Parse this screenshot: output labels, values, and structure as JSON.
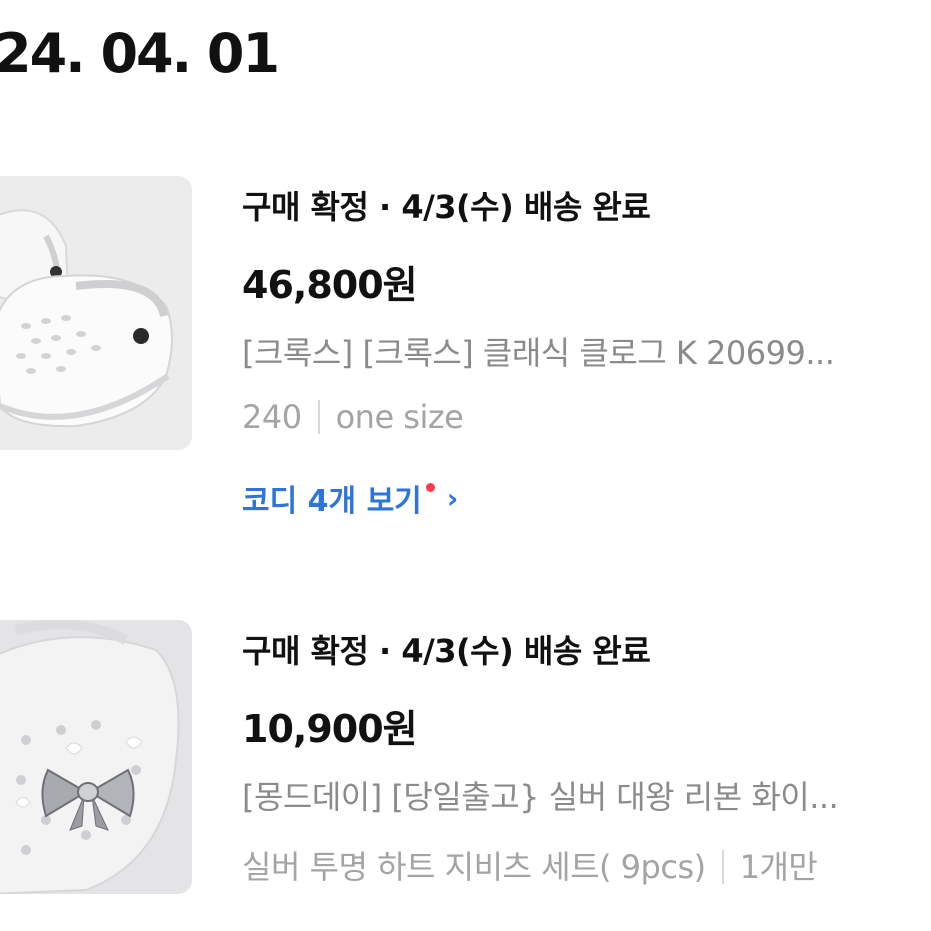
{
  "order_date": "24. 04. 01",
  "orders": [
    {
      "status": "구매 확정 · 4/3(수) 배송 완료",
      "price": "46,800원",
      "product_name": "[크록스] [크록스] 클래식 클로그 K 20699...",
      "option_size": "240",
      "option_detail": "one size",
      "image": "white-crocs-clog-photo",
      "coordi_link": "코디 4개 보기",
      "coordi_new_dot_color": "#ff3b4a",
      "link_color": "#2f74d8"
    },
    {
      "status": "구매 확정 · 4/3(수) 배송 완료",
      "price": "10,900원",
      "product_name": "[몽드데이] [당일출고} 실버 대왕 리본 화이...",
      "option_text": "실버 투명 하트 지비츠 세트( 9pcs)",
      "option_qty": "1개만",
      "image": "silver-ribbon-jibbitz-photo"
    }
  ]
}
